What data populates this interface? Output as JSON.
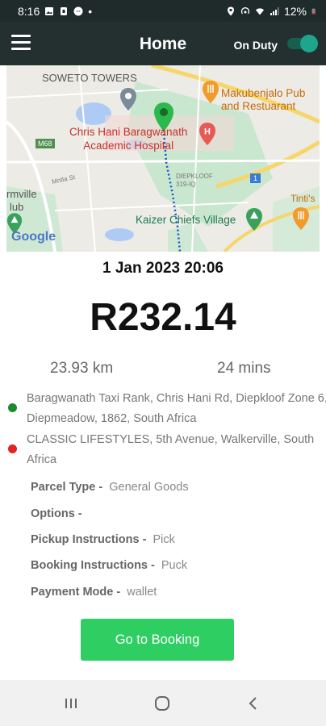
{
  "status_bar": {
    "time": "8:16",
    "dot": "•",
    "battery_percent": "12%",
    "icons_left": [
      "gallery-icon",
      "notification-lock-icon",
      "messenger-icon"
    ],
    "icons_right": [
      "location-icon",
      "hotspot-icon",
      "wifi-icon",
      "signal-icon",
      "battery-icon"
    ]
  },
  "app_bar": {
    "menu_icon": "hamburger-menu-icon",
    "title": "Home",
    "duty_label": "On Duty",
    "duty_toggle_on": true
  },
  "map": {
    "labels": {
      "soweto": "SOWETO TOWERS",
      "pub": "Makubenjalo Pub\nand Restuarant",
      "hospital": "Chris Hani Baragwanath\nAcademic Hospital",
      "diepkloof": "DIEPKLOOF\n319-IQ",
      "road_m68": "M68",
      "road_1": "1",
      "kaizer": "Kaizer Chiefs Village",
      "tintis": "Tinti's",
      "rmville": "rmville",
      "club": "lub",
      "google": "Google",
      "minor_street": "Mntla St"
    },
    "colors": {
      "route": "#1a56c8",
      "pin": "#2db84d"
    }
  },
  "trip": {
    "datetime": "1 Jan 2023 20:06",
    "fare": "R232.14",
    "distance": "23.93 km",
    "duration": "24 mins",
    "pickup_address": "Baragwanath Taxi Rank, Chris Hani Rd, Diepkloof Zone 6, Diepmeadow, 1862, South Africa",
    "dropoff_address": "CLASSIC LIFESTYLES, 5th Avenue, Walkerville, South Africa",
    "pickup_color": "#1a8a2a",
    "dropoff_color": "#e32222"
  },
  "details": {
    "parcel_type_label": "Parcel Type -",
    "parcel_type_value": "General Goods",
    "options_label": "Options -",
    "options_value": "",
    "pickup_instructions_label": "Pickup Instructions -",
    "pickup_instructions_value": "Pick",
    "booking_instructions_label": "Booking Instructions -",
    "booking_instructions_value": "Puck",
    "payment_mode_label": "Payment Mode -",
    "payment_mode_value": "wallet"
  },
  "cta": {
    "label": "Go to Booking",
    "color": "#2ece63"
  },
  "nav_bar": {
    "recents_icon": "recents-icon",
    "home_icon": "home-icon",
    "back_icon": "back-icon"
  }
}
